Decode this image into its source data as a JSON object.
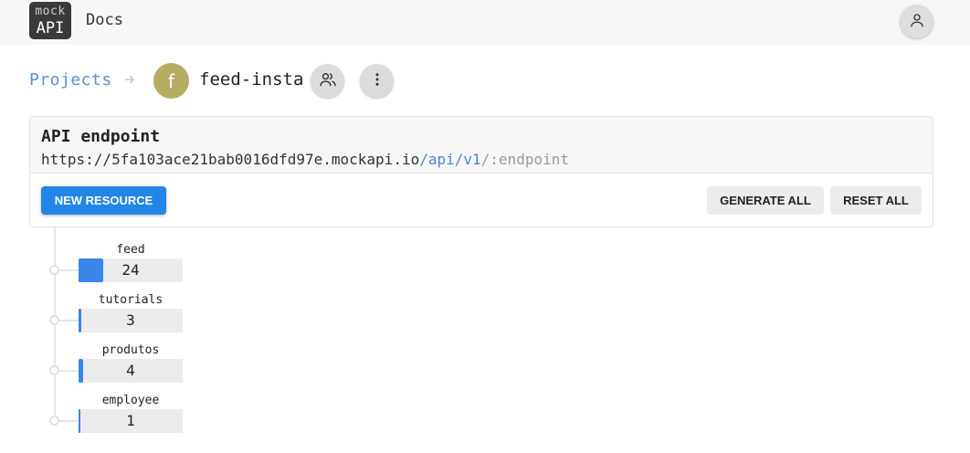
{
  "header": {
    "logo_top": "mock",
    "logo_bottom": "API",
    "docs_label": "Docs",
    "account_icon": "user-icon"
  },
  "breadcrumb": {
    "projects_label": "Projects",
    "separator_icon": "arrow-right-icon",
    "project_initial": "f",
    "project_name": "feed-insta",
    "members_icon": "users-icon",
    "more_icon": "more-vertical-icon"
  },
  "endpoint": {
    "title": "API endpoint",
    "url_host": "https://5fa103ace21bab0016dfd97e.mockapi.io",
    "url_path": "/api/v1",
    "url_param": "/:endpoint"
  },
  "actions": {
    "new_resource_label": "NEW RESOURCE",
    "generate_all_label": "GENERATE ALL",
    "reset_all_label": "RESET ALL"
  },
  "resources": [
    {
      "name": "feed",
      "count": "24",
      "fill_fraction": 0.24
    },
    {
      "name": "tutorials",
      "count": "3",
      "fill_fraction": 0.03
    },
    {
      "name": "produtos",
      "count": "4",
      "fill_fraction": 0.04
    },
    {
      "name": "employee",
      "count": "1",
      "fill_fraction": 0.01
    }
  ],
  "colors": {
    "accent": "#2386e6",
    "link": "#5b8fd6",
    "avatar": "#b5ad62",
    "bar_fill": "#3a86e8"
  }
}
